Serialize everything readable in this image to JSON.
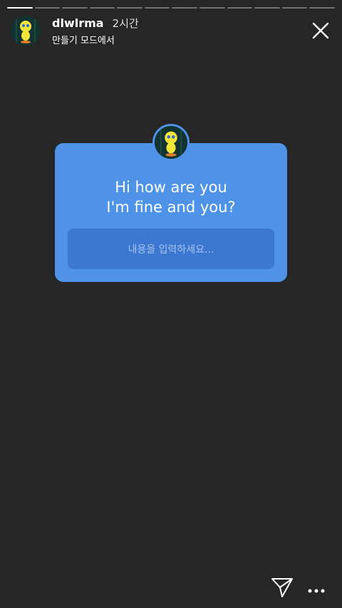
{
  "story": {
    "segments": 12,
    "active_index": 0
  },
  "header": {
    "username": "dlwlrma",
    "time": "2시간",
    "subtitle": "만들기 모드에서"
  },
  "question_card": {
    "line1": "Hi how are you",
    "line2": "I'm fine and you?",
    "placeholder": "내용을 입력하세요..."
  },
  "icons": {
    "close": "close-icon",
    "send": "paper-plane-icon",
    "more": "more-dots-icon"
  },
  "colors": {
    "background": "#262626",
    "card": "#4f93e8",
    "input": "#3c78d1"
  }
}
